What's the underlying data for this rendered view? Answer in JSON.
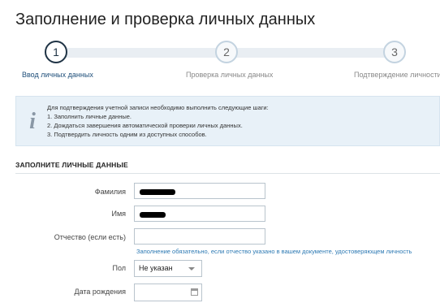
{
  "page": {
    "title": "Заполнение и проверка личных данных"
  },
  "stepper": {
    "steps": [
      {
        "number": "1",
        "label": "Ввод личных данных"
      },
      {
        "number": "2",
        "label": "Проверка личных данных"
      },
      {
        "number": "3",
        "label": "Подтверждение личности"
      }
    ]
  },
  "info": {
    "icon": "info-icon",
    "heading": "Для подтверждения учетной записи необходимо выполнить следующие шаги:",
    "items": [
      "1. Заполнить личные данные.",
      "2. Дождаться завершения автоматической проверки личных данных.",
      "3. Подтвердить личность одним из доступных способов."
    ]
  },
  "form": {
    "section_title": "ЗАПОЛНИТЕ ЛИЧНЫЕ ДАННЫЕ",
    "last_name_label": "Фамилия",
    "first_name_label": "Имя",
    "middle_name_label": "Отчество (если есть)",
    "middle_name_hint": "Заполнение обязательно, если отчество указано в вашем документе, удостоверяющем личность",
    "gender_label": "Пол",
    "gender_value": "Не указан",
    "birth_date_label": "Дата рождения"
  }
}
